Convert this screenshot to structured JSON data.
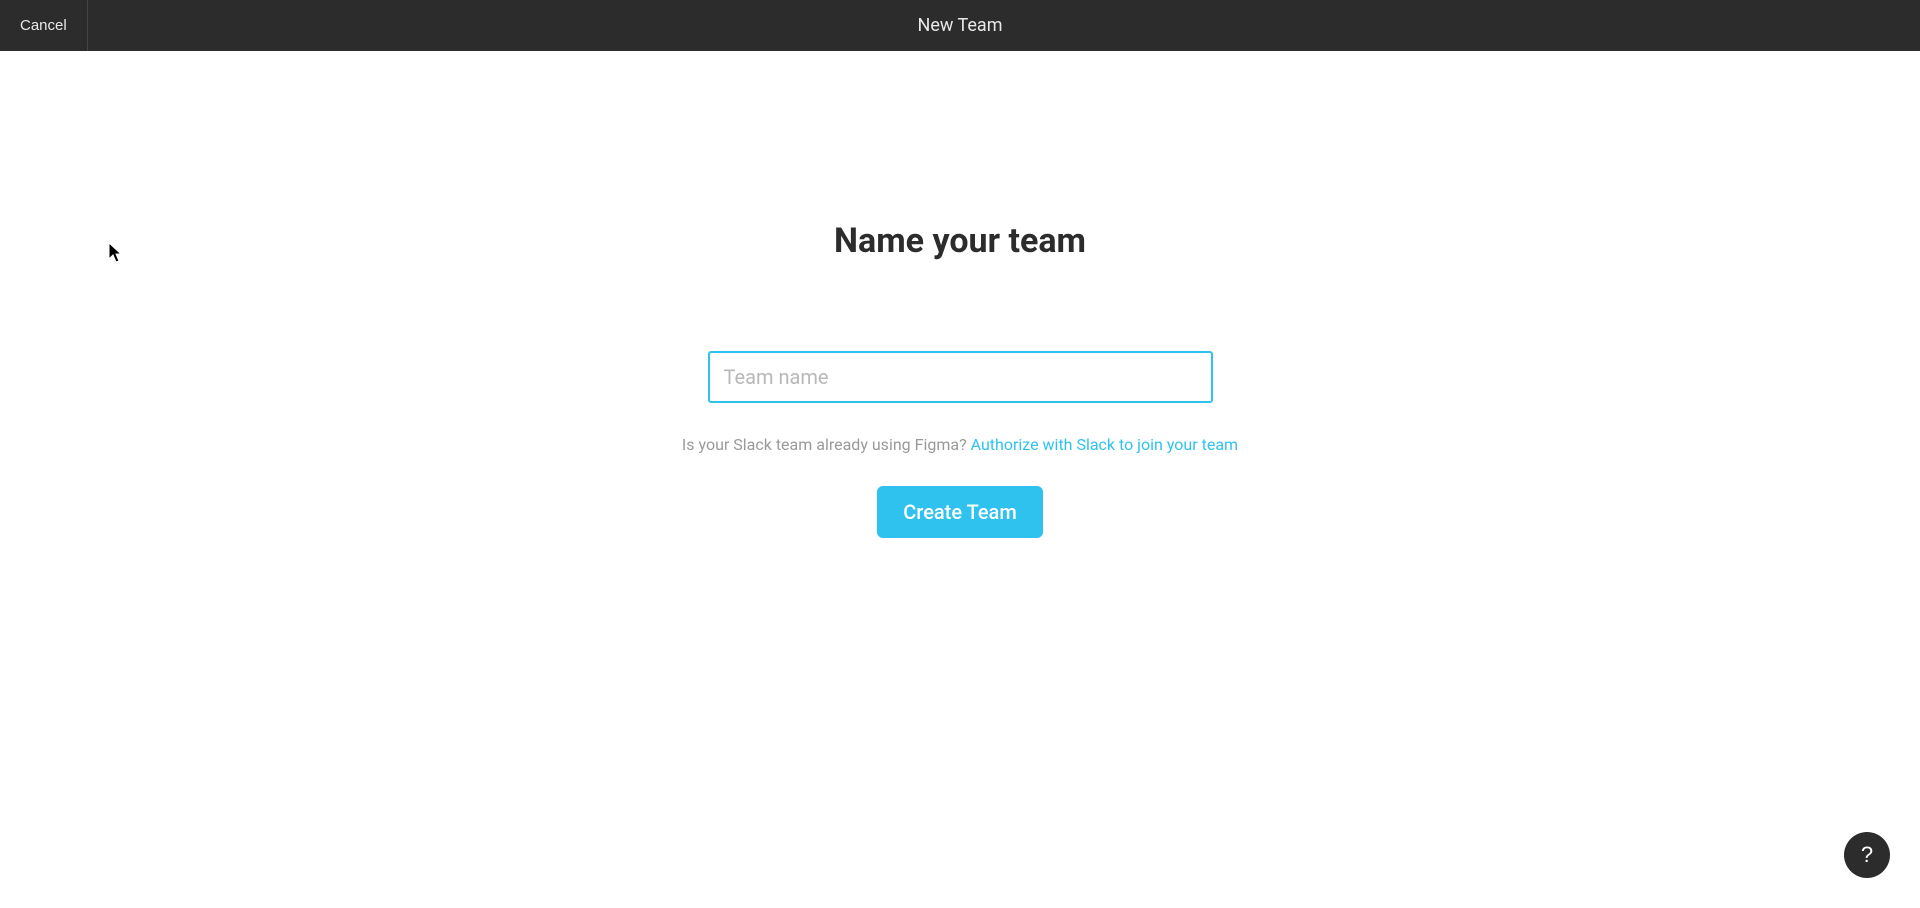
{
  "topbar": {
    "cancel_label": "Cancel",
    "title": "New Team"
  },
  "main": {
    "heading": "Name your team",
    "team_input_placeholder": "Team name",
    "team_input_value": "",
    "slack_prompt": "Is your Slack team already using Figma? ",
    "slack_link_label": "Authorize with Slack to join your team",
    "create_button_label": "Create Team"
  },
  "help": {
    "label": "?"
  }
}
